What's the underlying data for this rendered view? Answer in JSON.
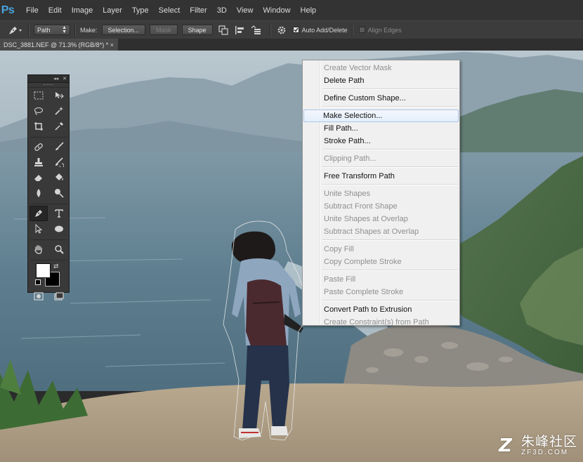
{
  "app": {
    "logo": "Ps"
  },
  "menu": [
    "File",
    "Edit",
    "Image",
    "Layer",
    "Type",
    "Select",
    "Filter",
    "3D",
    "View",
    "Window",
    "Help"
  ],
  "options": {
    "tool_icon": "pen-tool-icon",
    "mode_value": "Path",
    "make_label": "Make:",
    "selection_btn": "Selection...",
    "mask_btn": "Mask",
    "shape_btn": "Shape",
    "auto_add_delete": {
      "label": "Auto Add/Delete",
      "checked": true
    },
    "align_edges": {
      "label": "Align Edges",
      "checked": false
    }
  },
  "document": {
    "tab_title": "DSC_3881.NEF @ 71.3% (RGB/8*) *",
    "close_glyph": "×"
  },
  "context_menu": {
    "groups": [
      [
        {
          "label": "Create Vector Mask",
          "enabled": false
        },
        {
          "label": "Delete Path",
          "enabled": true
        }
      ],
      [
        {
          "label": "Define Custom Shape...",
          "enabled": true
        }
      ],
      [
        {
          "label": "Make Selection...",
          "enabled": true,
          "highlighted": true
        },
        {
          "label": "Fill Path...",
          "enabled": true
        },
        {
          "label": "Stroke Path...",
          "enabled": true
        }
      ],
      [
        {
          "label": "Clipping Path...",
          "enabled": false
        }
      ],
      [
        {
          "label": "Free Transform Path",
          "enabled": true
        }
      ],
      [
        {
          "label": "Unite Shapes",
          "enabled": false
        },
        {
          "label": "Subtract Front Shape",
          "enabled": false
        },
        {
          "label": "Unite Shapes at Overlap",
          "enabled": false
        },
        {
          "label": "Subtract Shapes at Overlap",
          "enabled": false
        }
      ],
      [
        {
          "label": "Copy Fill",
          "enabled": false
        },
        {
          "label": "Copy Complete Stroke",
          "enabled": false
        }
      ],
      [
        {
          "label": "Paste Fill",
          "enabled": false
        },
        {
          "label": "Paste Complete Stroke",
          "enabled": false
        }
      ],
      [
        {
          "label": "Convert Path to Extrusion",
          "enabled": true
        },
        {
          "label": "Create Constraint(s) from Path",
          "enabled": false
        }
      ]
    ]
  },
  "tools_panel": {
    "rows": [
      [
        "marquee-tool-icon",
        "move-tool-icon"
      ],
      [
        "lasso-tool-icon",
        "magic-wand-tool-icon"
      ],
      [
        "crop-tool-icon",
        "eyedropper-tool-icon"
      ],
      [
        "healing-brush-tool-icon",
        "brush-tool-icon"
      ],
      [
        "clone-stamp-tool-icon",
        "history-brush-tool-icon"
      ],
      [
        "eraser-tool-icon",
        "paint-bucket-tool-icon"
      ],
      [
        "blur-tool-icon",
        "dodge-tool-icon"
      ],
      [
        "pen-tool-icon",
        "type-tool-icon"
      ],
      [
        "path-selection-tool-icon",
        "ellipse-tool-icon"
      ],
      [
        "hand-tool-icon",
        "zoom-tool-icon"
      ]
    ],
    "active_tool": "pen-tool-icon",
    "foreground_color": "#ffffff",
    "background_color": "#000000"
  },
  "watermark": {
    "name": "朱峰社区",
    "url": "ZF3D.COM"
  },
  "colors": {
    "menubar": "#333333",
    "optionsbar": "#3c3c3c",
    "accent": "#4aa3df",
    "menu_highlight": "#e4eefb"
  }
}
